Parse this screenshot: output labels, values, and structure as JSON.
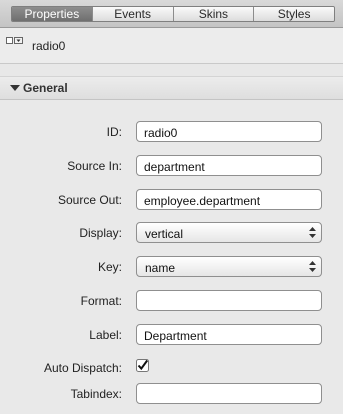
{
  "tabs": [
    "Properties",
    "Events",
    "Skins",
    "Styles"
  ],
  "component": {
    "name": "radio0",
    "icon": "radio-dropdown-icon"
  },
  "section": {
    "title": "General",
    "icon": "disclosure-triangle-down-icon"
  },
  "fields": {
    "id": {
      "label": "ID:",
      "value": "radio0"
    },
    "source_in": {
      "label": "Source In:",
      "value": "department"
    },
    "source_out": {
      "label": "Source Out:",
      "value": "employee.department"
    },
    "display": {
      "label": "Display:",
      "value": "vertical",
      "icon": "stepper-arrows-icon"
    },
    "key": {
      "label": "Key:",
      "value": "name",
      "icon": "stepper-arrows-icon"
    },
    "format": {
      "label": "Format:",
      "value": ""
    },
    "label": {
      "label": "Label:",
      "value": "Department"
    },
    "auto_dispatch": {
      "label": "Auto Dispatch:",
      "checked": true,
      "icon": "checkmark-icon"
    },
    "tabindex": {
      "label": "Tabindex:",
      "value": ""
    }
  }
}
